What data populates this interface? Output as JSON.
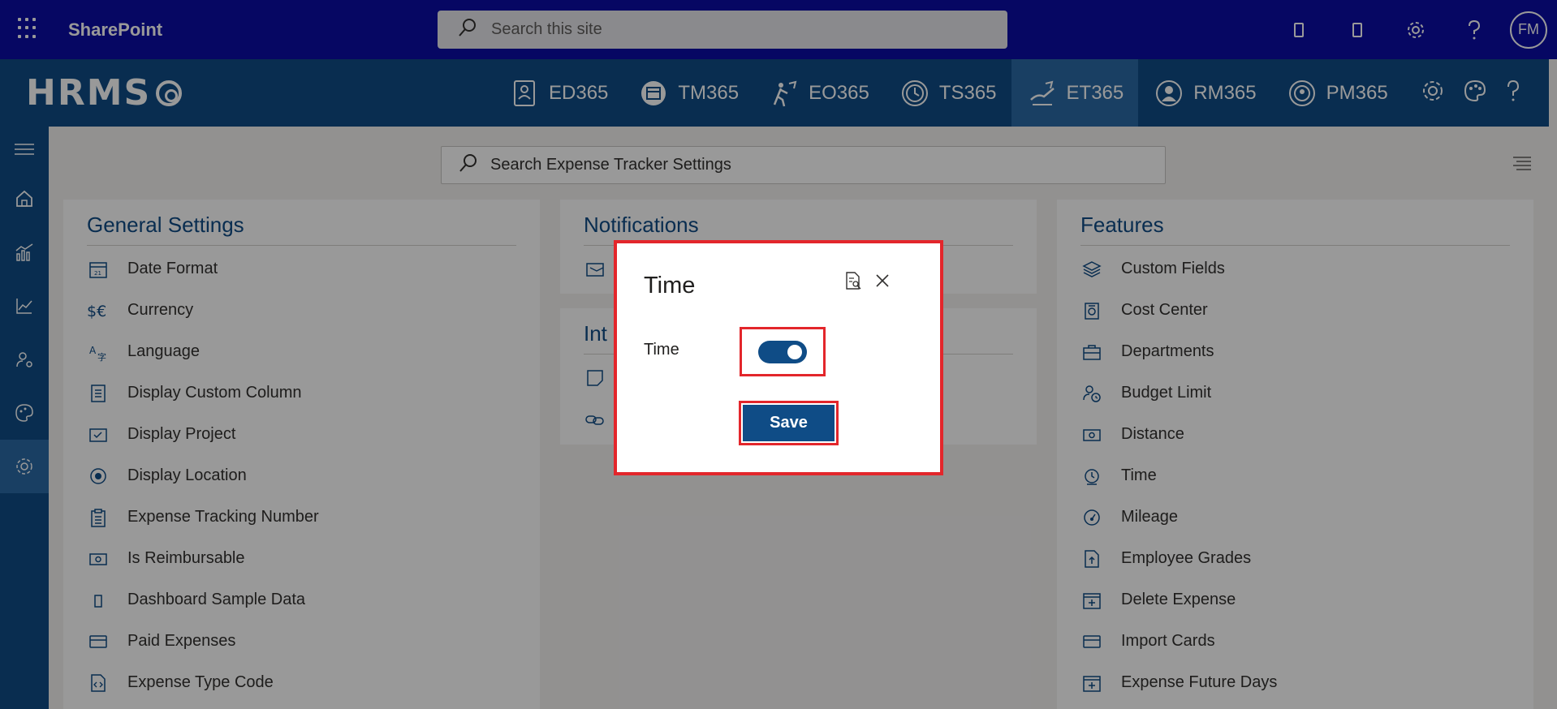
{
  "suite": {
    "title": "SharePoint",
    "search_placeholder": "Search this site",
    "avatar_initials": "FM"
  },
  "app": {
    "logo": "HRMS",
    "modules": [
      {
        "label": "ED365",
        "icon": "employee-directory-icon"
      },
      {
        "label": "TM365",
        "icon": "task-manager-icon"
      },
      {
        "label": "EO365",
        "icon": "employee-onboarding-icon"
      },
      {
        "label": "TS365",
        "icon": "timesheet-icon"
      },
      {
        "label": "ET365",
        "icon": "expense-tracker-icon",
        "active": true
      },
      {
        "label": "RM365",
        "icon": "recruitment-icon"
      },
      {
        "label": "PM365",
        "icon": "performance-icon"
      }
    ]
  },
  "main": {
    "search_placeholder": "Search Expense Tracker Settings"
  },
  "general_settings": {
    "title": "General Settings",
    "items": [
      {
        "label": "Date Format",
        "icon": "calendar-icon"
      },
      {
        "label": "Currency",
        "icon": "currency-icon"
      },
      {
        "label": "Language",
        "icon": "language-icon"
      },
      {
        "label": "Display Custom Column",
        "icon": "document-icon"
      },
      {
        "label": "Display Project",
        "icon": "project-icon"
      },
      {
        "label": "Display Location",
        "icon": "location-icon"
      },
      {
        "label": "Expense Tracking Number",
        "icon": "clipboard-icon"
      },
      {
        "label": "Is Reimbursable",
        "icon": "money-icon"
      },
      {
        "label": "Dashboard Sample Data",
        "icon": "phone-icon"
      },
      {
        "label": "Paid Expenses",
        "icon": "card-icon"
      },
      {
        "label": "Expense Type Code",
        "icon": "code-file-icon"
      }
    ]
  },
  "notifications": {
    "title": "Notifications"
  },
  "integrations": {
    "title": "Int"
  },
  "features": {
    "title": "Features",
    "items": [
      {
        "label": "Custom Fields",
        "icon": "layers-icon"
      },
      {
        "label": "Cost Center",
        "icon": "cost-center-icon"
      },
      {
        "label": "Departments",
        "icon": "briefcase-icon"
      },
      {
        "label": "Budget Limit",
        "icon": "person-clock-icon"
      },
      {
        "label": "Distance",
        "icon": "money-icon"
      },
      {
        "label": "Time",
        "icon": "clock-icon"
      },
      {
        "label": "Mileage",
        "icon": "gauge-icon"
      },
      {
        "label": "Employee Grades",
        "icon": "file-upload-icon"
      },
      {
        "label": "Delete Expense",
        "icon": "calendar-add-icon"
      },
      {
        "label": "Import Cards",
        "icon": "card-icon"
      },
      {
        "label": "Expense Future Days",
        "icon": "calendar-add-icon"
      }
    ]
  },
  "dialog": {
    "title": "Time",
    "field_label": "Time",
    "toggle_on": true,
    "save_label": "Save"
  },
  "colors": {
    "suite_bar": "#0b0ca6",
    "app_bar": "#0f4c86",
    "active_module": "#2b6aa6",
    "highlight": "#e3262b"
  }
}
